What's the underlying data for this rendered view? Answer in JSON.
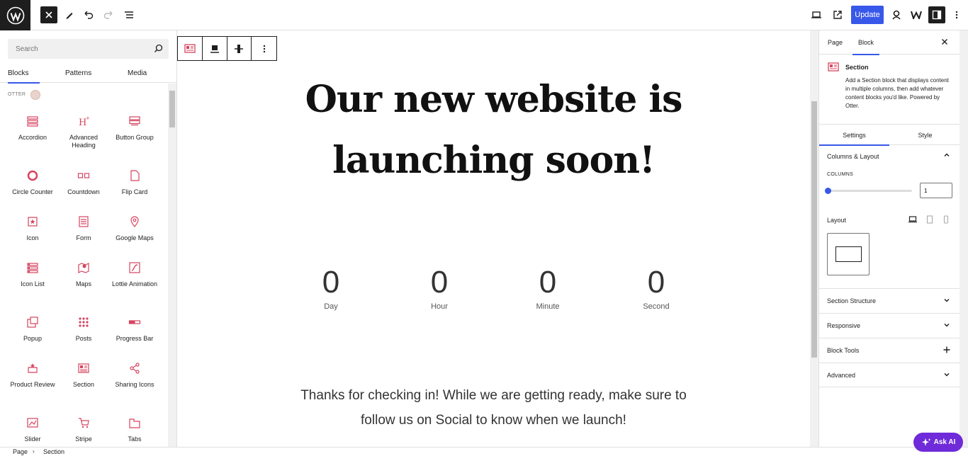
{
  "topbar": {
    "update_label": "Update"
  },
  "inserter": {
    "search_placeholder": "Search",
    "tabs": [
      "Blocks",
      "Patterns",
      "Media"
    ],
    "category": "OTTER",
    "blocks": [
      {
        "label": "Accordion",
        "icon": "accordion-icon"
      },
      {
        "label": "Advanced Heading",
        "icon": "advanced-heading-icon"
      },
      {
        "label": "Button Group",
        "icon": "button-group-icon"
      },
      {
        "label": "Circle Counter",
        "icon": "circle-counter-icon"
      },
      {
        "label": "Countdown",
        "icon": "countdown-icon"
      },
      {
        "label": "Flip Card",
        "icon": "flip-card-icon"
      },
      {
        "label": "Icon",
        "icon": "icon-block-icon"
      },
      {
        "label": "Form",
        "icon": "form-icon"
      },
      {
        "label": "Google Maps",
        "icon": "map-pin-icon"
      },
      {
        "label": "Icon List",
        "icon": "icon-list-icon"
      },
      {
        "label": "Maps",
        "icon": "maps-icon"
      },
      {
        "label": "Lottie Animation",
        "icon": "lottie-icon"
      },
      {
        "label": "Popup",
        "icon": "popup-icon"
      },
      {
        "label": "Posts",
        "icon": "posts-grid-icon"
      },
      {
        "label": "Progress Bar",
        "icon": "progress-bar-icon"
      },
      {
        "label": "Product Review",
        "icon": "product-review-icon"
      },
      {
        "label": "Section",
        "icon": "section-icon"
      },
      {
        "label": "Sharing Icons",
        "icon": "share-icon"
      },
      {
        "label": "Slider",
        "icon": "slider-icon"
      },
      {
        "label": "Stripe",
        "icon": "cart-icon"
      },
      {
        "label": "Tabs",
        "icon": "tabs-icon"
      }
    ]
  },
  "canvas": {
    "headline_line1": "Our new website is",
    "headline_line2": "launching soon!",
    "countdown": [
      {
        "value": "0",
        "label": "Day"
      },
      {
        "value": "0",
        "label": "Hour"
      },
      {
        "value": "0",
        "label": "Minute"
      },
      {
        "value": "0",
        "label": "Second"
      }
    ],
    "thanks_line1": "Thanks for checking in! While we are getting ready, make sure to",
    "thanks_line2": "follow us on Social to know when we launch!"
  },
  "sidebar": {
    "tabs": [
      "Page",
      "Block"
    ],
    "block_title": "Section",
    "block_desc": "Add a Section block that displays content in multiple columns, then add whatever content blocks you'd like. Powered by Otter.",
    "sub_tabs": [
      "Settings",
      "Style"
    ],
    "columns_layout": "Columns & Layout",
    "columns_label": "COLUMNS",
    "columns_value": "1",
    "columns_fraction": 0.0,
    "layout_label": "Layout",
    "panels": [
      "Section Structure",
      "Responsive",
      "Block Tools",
      "Advanced"
    ]
  },
  "footer": {
    "crumbs": [
      "Page",
      "Section"
    ],
    "ask_ai": "Ask AI"
  },
  "colors": {
    "accent": "#3858e9",
    "otter_icon": "#d6445f",
    "ask_ai": "#6f2bd9"
  }
}
